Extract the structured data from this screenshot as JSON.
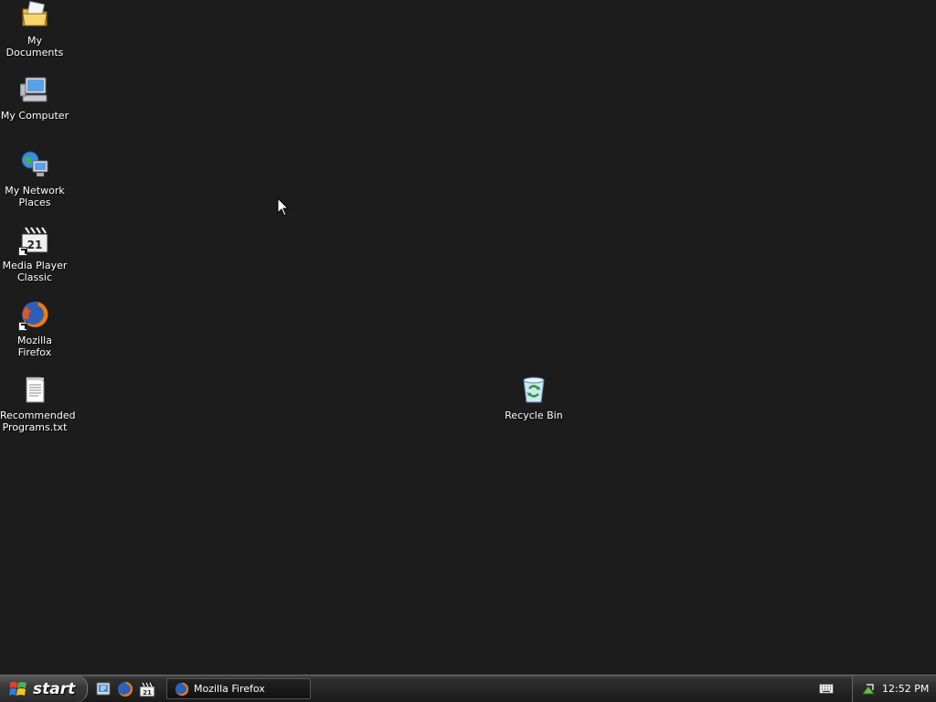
{
  "desktop": {
    "icons": [
      {
        "label": "My Documents",
        "icon": "my-documents-icon"
      },
      {
        "label": "My Computer",
        "icon": "my-computer-icon"
      },
      {
        "label": "My Network\nPlaces",
        "icon": "network-places-icon"
      },
      {
        "label": "Media Player\nClassic",
        "icon": "media-player-classic-icon"
      },
      {
        "label": "Mozilla Firefox",
        "icon": "firefox-icon"
      },
      {
        "label": "Recommended\nPrograms.txt",
        "icon": "text-file-icon"
      },
      {
        "label": "Recycle Bin",
        "icon": "recycle-bin-icon"
      }
    ]
  },
  "taskbar": {
    "start_label": "start",
    "quick_launch": [
      "show-desktop-icon",
      "firefox-icon",
      "media-player-classic-icon"
    ],
    "tasks": [
      {
        "label": "Mozilla Firefox",
        "icon": "firefox-icon"
      }
    ],
    "tray": {
      "icons": [
        "keyboard-icon",
        "network-icon"
      ],
      "clock": "12:52 PM"
    }
  },
  "colors": {
    "desktop_background": "#1c1c1c",
    "taskbar": "#262626",
    "text": "#ffffff"
  }
}
